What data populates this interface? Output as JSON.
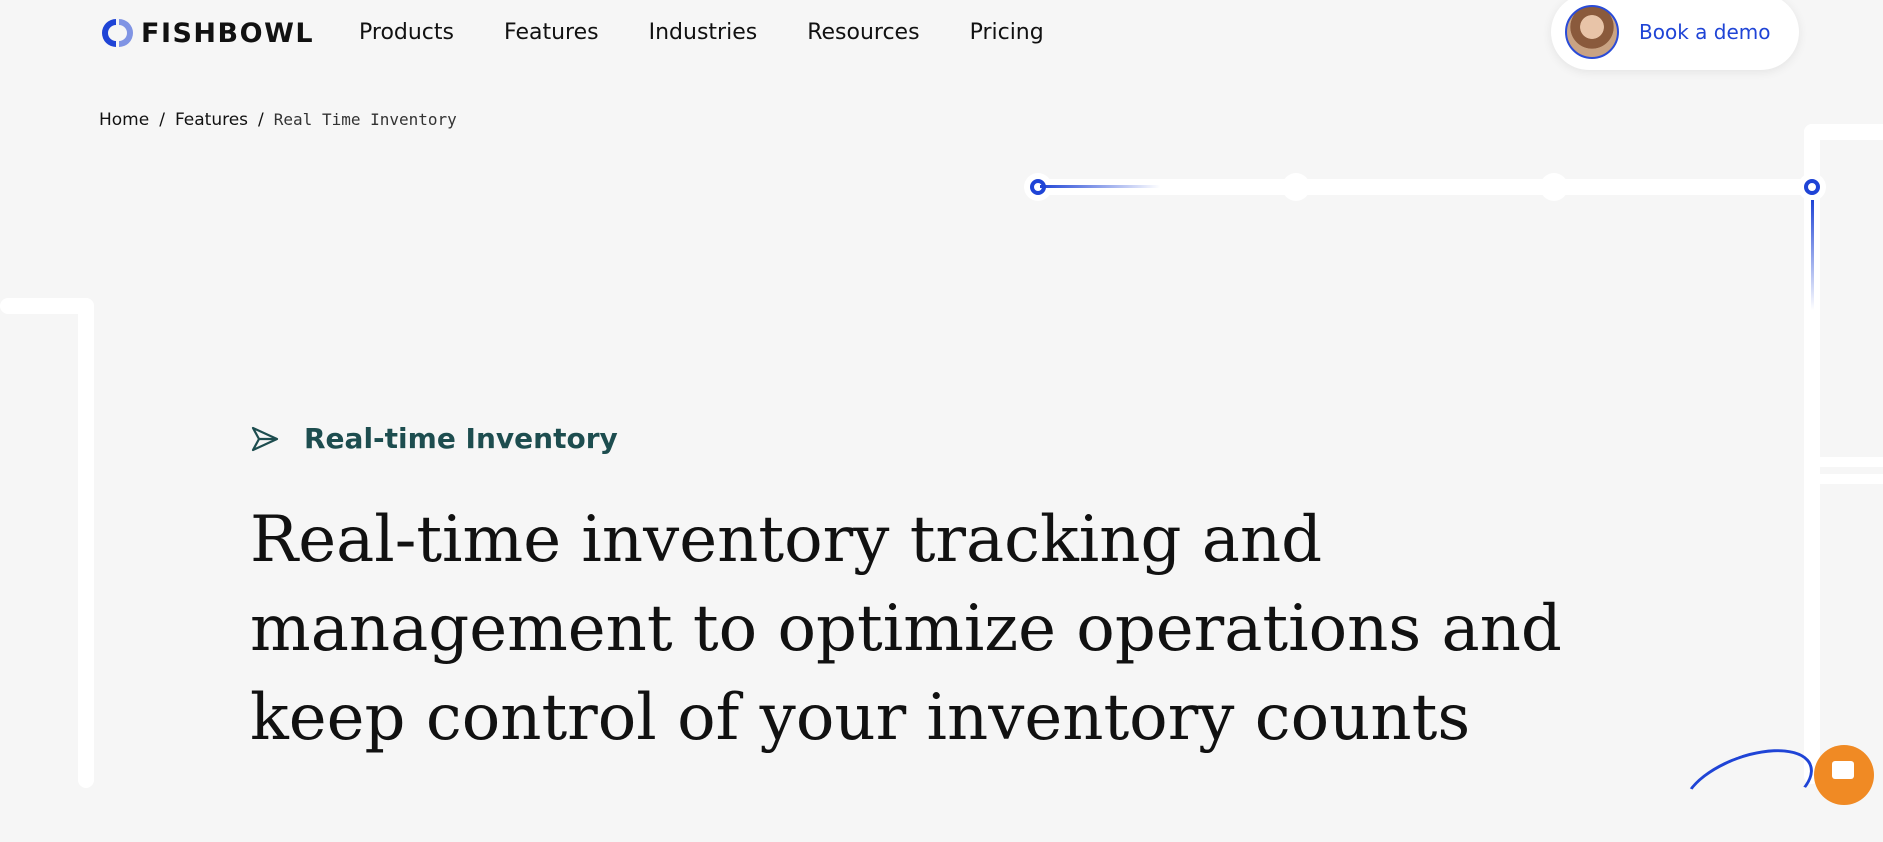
{
  "brand": {
    "name": "FISHBOWL",
    "accent": "#1f44d6"
  },
  "nav": {
    "items": [
      "Products",
      "Features",
      "Industries",
      "Resources",
      "Pricing"
    ]
  },
  "cta": {
    "book_demo_label": "Book a demo"
  },
  "breadcrumb": {
    "home": "Home",
    "separator": "/",
    "features": "Features",
    "current": "Real Time Inventory"
  },
  "hero": {
    "eyebrow": "Real-time Inventory",
    "title": "Real-time inventory tracking and management to optimize operations and keep control of your inventory counts"
  },
  "icons": [
    "fishbowl-logo-icon",
    "avatar",
    "send-arrow-icon",
    "chat-icon"
  ],
  "colors": {
    "eyebrow": "#1d4d4f",
    "chat_fab": "#f08a24",
    "background": "#f6f6f6"
  }
}
